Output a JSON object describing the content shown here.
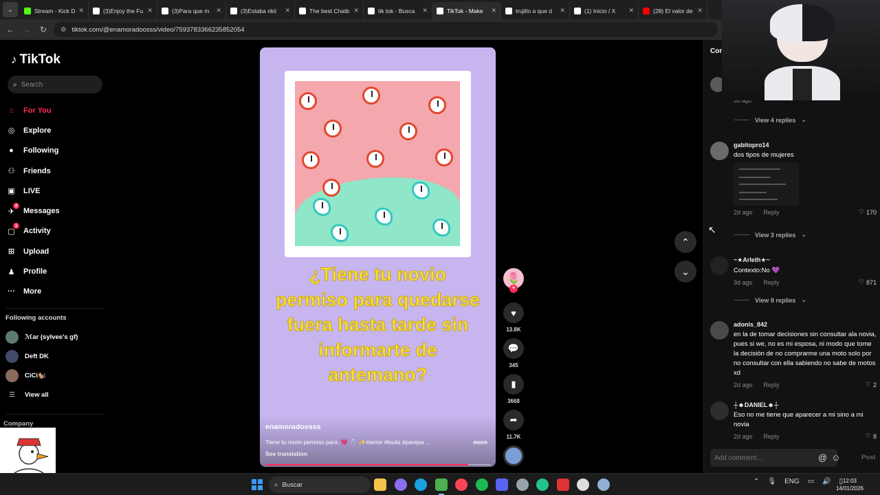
{
  "browser": {
    "tabs": [
      {
        "title": "Stream - Kick D",
        "color": "#53fc18",
        "active": false
      },
      {
        "title": "(3)Enjoy the Fu",
        "color": "#ffffff",
        "active": false
      },
      {
        "title": "(3)Para que m",
        "color": "#ffffff",
        "active": false
      },
      {
        "title": "(3)Estaba rikii",
        "color": "#ffffff",
        "active": false
      },
      {
        "title": "The best Chatb",
        "color": "#ffffff",
        "active": false
      },
      {
        "title": "tik tok - Busca",
        "color": "#ffffff",
        "active": false
      },
      {
        "title": "TikTok - Make",
        "color": "#ffffff",
        "active": true
      },
      {
        "title": "trujillo a que d",
        "color": "#ffffff",
        "active": false
      },
      {
        "title": "(1) Inicio / X",
        "color": "#ffffff",
        "active": false
      },
      {
        "title": "(28) El valor de",
        "color": "#ff0000",
        "active": false
      }
    ],
    "url": "tiktok.com/@enamoradoosss/video/7593783366235852054"
  },
  "sidebar": {
    "logo": "TikTok",
    "search_placeholder": "Search",
    "nav": [
      {
        "label": "For You",
        "icon": "home-icon",
        "glyph": "⌂",
        "active": true,
        "badge": ""
      },
      {
        "label": "Explore",
        "icon": "compass-icon",
        "glyph": "◎",
        "active": false,
        "badge": ""
      },
      {
        "label": "Following",
        "icon": "following-icon",
        "glyph": "●",
        "active": false,
        "badge": ""
      },
      {
        "label": "Friends",
        "icon": "friends-icon",
        "glyph": "⚇",
        "active": false,
        "badge": ""
      },
      {
        "label": "LIVE",
        "icon": "live-icon",
        "glyph": "▣",
        "active": false,
        "badge": ""
      },
      {
        "label": "Messages",
        "icon": "messages-icon",
        "glyph": "✈",
        "active": false,
        "badge": "2"
      },
      {
        "label": "Activity",
        "icon": "activity-icon",
        "glyph": "▢",
        "active": false,
        "badge": "1"
      },
      {
        "label": "Upload",
        "icon": "upload-icon",
        "glyph": "⊞",
        "active": false,
        "badge": ""
      },
      {
        "label": "Profile",
        "icon": "profile-icon",
        "glyph": "♟",
        "active": false,
        "badge": ""
      },
      {
        "label": "More",
        "icon": "more-icon",
        "glyph": "···",
        "active": false,
        "badge": ""
      }
    ],
    "following_title": "Following accounts",
    "following": [
      {
        "name": "ℳar (sylvee's gf)",
        "color": "#5d7b6f"
      },
      {
        "name": "Deft DK",
        "color": "#3e4a66"
      },
      {
        "name": "CiCi🐿️",
        "color": "#8a6a5a"
      }
    ],
    "view_all": "View all",
    "company": "Company"
  },
  "video": {
    "overlay_text": "¿Tiene tu novio permiso para quedarse fuera hasta tarde sin informarte de antemano?",
    "author": "enamoradoosss",
    "description": "Tiene tu novio permiso para..💗 💍 ✨#amor #boda #parejas ...",
    "more": "more",
    "see_translation": "See translation",
    "progress": 0.9
  },
  "actions": {
    "likes": "13.8K",
    "comments": "345",
    "saves": "3668",
    "shares": "11.7K"
  },
  "comments_panel": {
    "header": "Con",
    "top_meta": "3d ago",
    "view_replies": [
      "View 4 replies",
      "View 3 replies",
      "View 8 replies"
    ],
    "items": [
      {
        "user": "gabitopro14",
        "text": "dos tipos de mujeres",
        "time": "2d ago",
        "likes": "170",
        "reply": "Reply",
        "avatar_color": "#6a6a6a"
      },
      {
        "user": "~★Arleth★~",
        "text": "Contexto:No 💜",
        "time": "3d ago",
        "likes": "871",
        "reply": "Reply",
        "avatar_color": "#222222"
      },
      {
        "user": "adonis_842",
        "text": "en la de tomar decisiones sin consultar ala novia, pues si we, no es mi esposa, ni modo que tome la decisión de no comprarme una moto solo por no consultar con ella sabiendo no sabe de motos xd",
        "time": "2d ago",
        "likes": "2",
        "reply": "Reply",
        "avatar_color": "#4a4a4a"
      },
      {
        "user": "┼☻DANIEL☻┼",
        "text": "Eso no me tiene que aparecer a mi sino a mi novia",
        "time": "2d ago",
        "likes": "8",
        "reply": "Reply",
        "avatar_color": "#2e2e2e"
      }
    ],
    "add_placeholder": "Add comment...",
    "post": "Post"
  },
  "taskbar": {
    "search": "Buscar",
    "lang": "ENG",
    "time": "12:03",
    "date": "14/01/2026",
    "apps": [
      {
        "name": "files-app-icon",
        "color": "#f6c24a"
      },
      {
        "name": "copilot-app-icon",
        "color": "#8b6cf0"
      },
      {
        "name": "edge-app-icon",
        "color": "#1ba1e2"
      },
      {
        "name": "chrome-app-icon",
        "color": "#4caf50"
      },
      {
        "name": "valorant-app-icon",
        "color": "#fa4454"
      },
      {
        "name": "spotify-app-icon",
        "color": "#1db954"
      },
      {
        "name": "discord-app-icon",
        "color": "#5865f2"
      },
      {
        "name": "steam-app-icon",
        "color": "#9aa3ad"
      },
      {
        "name": "gpt-app-icon",
        "color": "#27c28a"
      },
      {
        "name": "obs-app-icon",
        "color": "#d33"
      },
      {
        "name": "media-app-icon",
        "color": "#ddd"
      },
      {
        "name": "settings-app-icon",
        "color": "#8fb0d4"
      }
    ]
  }
}
